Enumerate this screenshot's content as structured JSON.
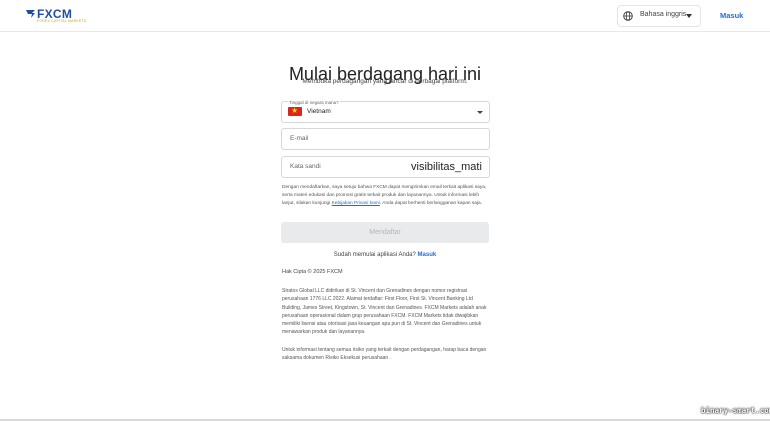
{
  "header": {
    "logo_text": "FXCM",
    "logo_sub": "FOREX CAPITAL MARKETS",
    "language_label": "Bahasa inggris",
    "login_label": "Masuk"
  },
  "main": {
    "title": "Mulai berdagang hari ini",
    "subtitle": "Membuka perdagangan yang lancar di berbagai platform.",
    "country_label": "Tinggal di negara mana?",
    "country_value": "Vietnam",
    "email_placeholder": "E-mail",
    "password_placeholder": "Kata sandi",
    "password_toggle": "visibilitas_mati",
    "consent_text_1": "Dengan mendaftarkan, saya setuju bahwa FXCM dapat mengirimkan email terkait aplikasi saya, serta materi edukasi dan promosi gratis terkait produk dan layanannya. Untuk informasi lebih lanjut, silakan kunjungi ",
    "consent_link": "Kebijakan Privasi kami",
    "consent_text_2": ". Anda dapat berhenti berlangganan kapan saja.",
    "submit_label": "Mendaftar",
    "already_text": "Sudah memulai aplikasi Anda?",
    "already_link": "Masuk"
  },
  "footer": {
    "copyright": "Hak Cipta © 2025 FXCM",
    "legal": "Stratos Global LLC didirikan di St. Vincent dan Grenadines dengan nomor registrasi perusahaan 1776 LLC 2022. Alamat terdaftar: First Floor, First St. Vincent Banking Ltd Building, James Street, Kingstown, St. Vincent dan Grenadines. FXCM Markets adalah anak perusahaan operasional dalam grup perusahaan FXCM. FXCM Markets tidak diwajibkan memiliki lisensi atau otorisasi jasa keuangan apa pun di St. Vincent dan Grenadines untuk menawarkan produk dan layanannya.",
    "risk": "Untuk informasi tentang semua risiko yang terkait dengan perdagangan, harap baca dengan saksama dokumen Risiko Eksekusi perusahaan ."
  },
  "watermark": "binary-smart.com",
  "colors": {
    "brand": "#1d4f9c",
    "link": "#1f6ed4",
    "flag": "#da251d"
  }
}
